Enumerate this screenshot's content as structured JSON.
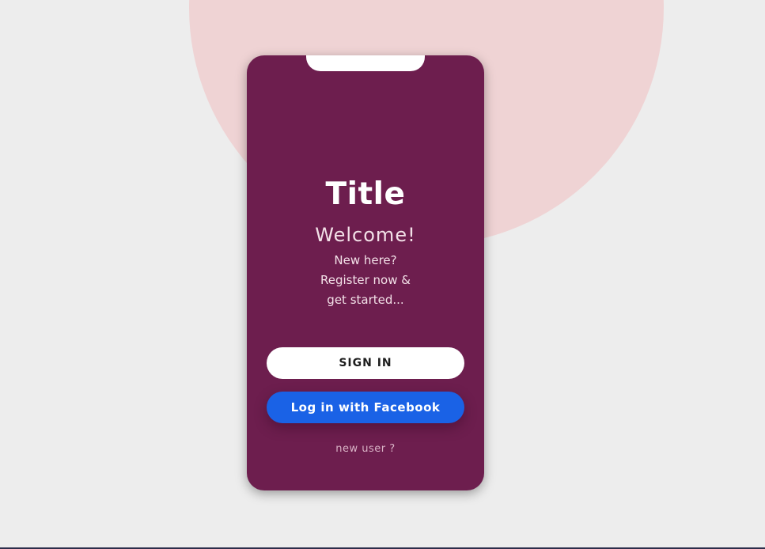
{
  "colors": {
    "page_background": "#ededed",
    "circle": "#efd3d4",
    "card": "#6d1e4e",
    "signin_button": "#ffffff",
    "facebook_button": "#1a62e6",
    "link_text": "#d9b3c6"
  },
  "card": {
    "title": "Title",
    "welcome": "Welcome!",
    "intro_lines": [
      "New here?",
      "Register now &",
      "get started..."
    ]
  },
  "buttons": {
    "signin_label": "SIGN IN",
    "facebook_label": "Log in with Facebook"
  },
  "links": {
    "new_user": "new user ?"
  }
}
